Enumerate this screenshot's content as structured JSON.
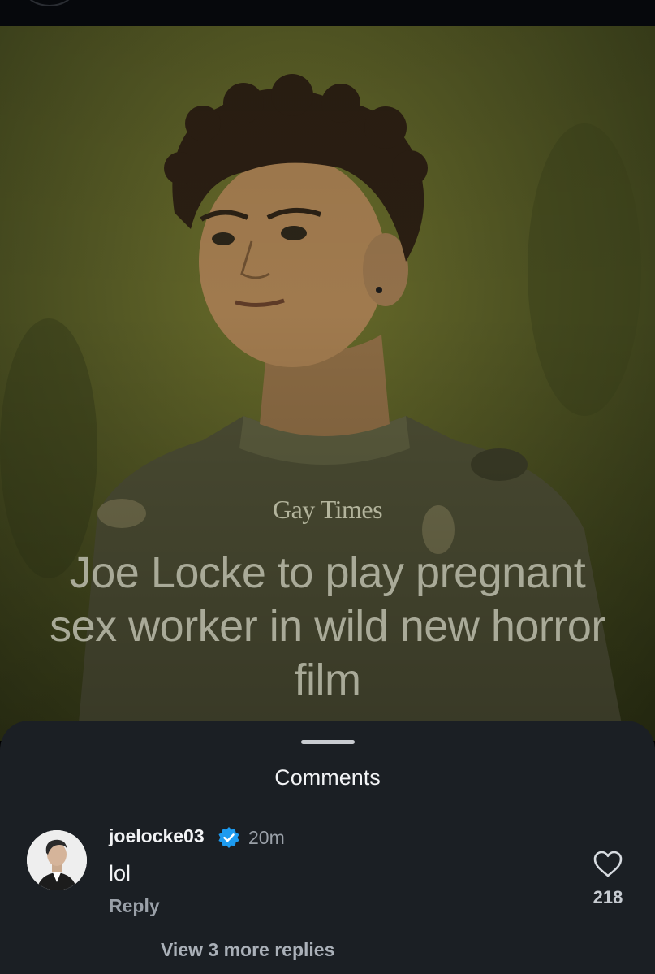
{
  "post": {
    "brand": "Gay Times",
    "headline": "Joe Locke to play pregnant sex worker in wild new horror film"
  },
  "comments_sheet": {
    "title": "Comments",
    "comment": {
      "username": "joelocke03",
      "verified": true,
      "time": "20m",
      "text": "lol",
      "reply_label": "Reply",
      "likes": "218",
      "view_replies": "View 3 more replies"
    }
  },
  "colors": {
    "sheet_bg": "#1b1f24",
    "verified_blue": "#1d9bf0",
    "photo_tint": "#545824"
  },
  "icons": [
    "verified-badge-icon",
    "heart-icon"
  ]
}
